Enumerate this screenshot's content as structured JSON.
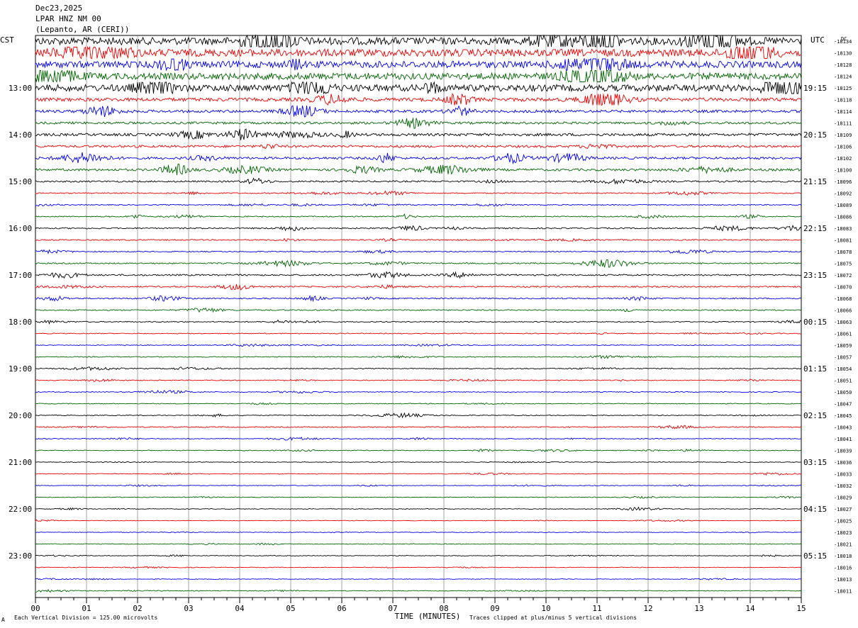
{
  "header": {
    "date": "Dec23,2025",
    "station": "LPAR HNZ NM 00",
    "location": "(Lepanto, AR (CERI))"
  },
  "footer": {
    "scale_note": "Each Vertical Division = 125.00 microvolts",
    "clip_note": "Traces clipped at plus/minus 5 vertical divisions",
    "corner_mark": "A"
  },
  "colors": {
    "trace_cycle": [
      "#000000",
      "#ee0000",
      "#0000ee",
      "#006400"
    ],
    "grid": "#808080",
    "text": "#000000"
  },
  "chart_data": {
    "type": "line",
    "title": "",
    "xlabel": "TIME (MINUTES)",
    "left_axis_label": "CST",
    "right_axis_label": "UTC",
    "dc_label": "DC",
    "x_ticks": [
      "00",
      "01",
      "02",
      "03",
      "04",
      "05",
      "06",
      "07",
      "08",
      "09",
      "10",
      "11",
      "12",
      "13",
      "14",
      "15"
    ],
    "xlim": [
      0,
      15
    ],
    "grid": true,
    "left_hour_labels": [
      "13:00",
      "14:00",
      "15:00",
      "16:00",
      "17:00",
      "18:00",
      "19:00",
      "20:00",
      "21:00",
      "22:00",
      "23:00"
    ],
    "right_hour_labels": [
      "19:15",
      "20:15",
      "21:15",
      "22:15",
      "23:15",
      "00:15",
      "01:15",
      "02:15",
      "03:15",
      "04:15",
      "05:15"
    ],
    "dc_offsets": [
      "-18134",
      "-18130",
      "-18128",
      "-18124",
      "-18125",
      "-18118",
      "-18114",
      "-18111",
      "-18109",
      "-18106",
      "-18102",
      "-18100",
      "-18096",
      "-18092",
      "-18089",
      "-18086",
      "-18083",
      "-18081",
      "-18078",
      "-18075",
      "-18072",
      "-18070",
      "-18068",
      "-18066",
      "-18063",
      "-18061",
      "-18059",
      "-18057",
      "-18054",
      "-18051",
      "-18050",
      "-18047",
      "-18045",
      "-18043",
      "-18041",
      "-18039",
      "-18036",
      "-18033",
      "-18032",
      "-18029",
      "-18027",
      "-18025",
      "-18023",
      "-18021",
      "-18018",
      "-18016",
      "-18013",
      "-18011"
    ],
    "trace_activity": [
      9,
      9,
      8,
      8,
      8,
      4,
      3,
      2.5,
      3,
      2.5,
      2.5,
      2.5,
      1.6,
      0.9,
      0.8,
      0.9,
      1.2,
      1,
      0.9,
      1.2,
      1.5,
      1.3,
      1.2,
      1,
      0.8,
      0.6,
      0.5,
      0.6,
      0.7,
      0.6,
      0.6,
      0.5,
      0.6,
      0.8,
      0.6,
      0.5,
      0.4,
      0.4,
      0.4,
      0.4,
      0.4,
      0.3,
      0.4,
      0.4,
      0.4,
      0.3,
      0.3,
      0.4
    ]
  }
}
